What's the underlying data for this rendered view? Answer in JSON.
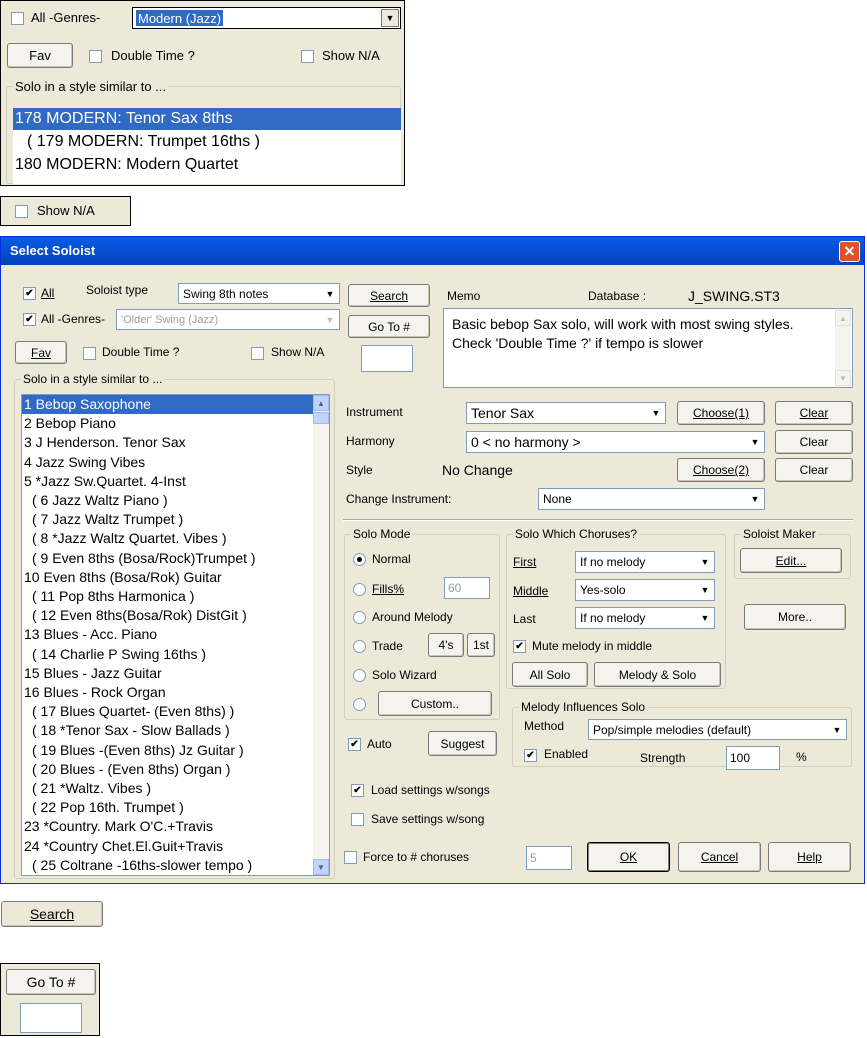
{
  "top_panel": {
    "all_genres": "All -Genres-",
    "genre_value": "Modern (Jazz)",
    "fav": "Fav",
    "double_time": "Double Time ?",
    "show_na": "Show N/A",
    "group_caption": "Solo in a style similar to ...",
    "items": [
      "178 MODERN: Tenor Sax 8ths",
      "( 179 MODERN: Trumpet 16ths )",
      "180 MODERN: Modern Quartet"
    ]
  },
  "show_na_crop": {
    "label": "Show N/A"
  },
  "dialog": {
    "title": "Select Soloist",
    "all": "All",
    "soloist_type_label": "Soloist type",
    "soloist_type_value": "Swing 8th notes",
    "all_genres": "All -Genres-",
    "genre_value": "'Older' Swing (Jazz)",
    "fav": "Fav",
    "double_time": "Double Time ?",
    "show_na": "Show N/A",
    "list_caption": "Solo in a style similar to ...",
    "list_items": [
      "1 Bebop Saxophone",
      "2 Bebop Piano",
      "3 J Henderson. Tenor Sax",
      "4 Jazz Swing Vibes",
      "5 *Jazz Sw.Quartet. 4-Inst",
      "( 6 Jazz Waltz Piano )",
      "( 7 Jazz Waltz Trumpet )",
      "( 8 *Jazz Waltz Quartet. Vibes )",
      "( 9 Even 8ths (Bosa/Rock)Trumpet )",
      "10 Even 8ths (Bosa/Rok) Guitar",
      "( 11 Pop 8ths Harmonica )",
      "( 12 Even 8ths(Bosa/Rok) DistGit )",
      "13 Blues - Acc. Piano",
      "( 14 Charlie P Swing 16ths )",
      "15 Blues - Jazz Guitar",
      "16 Blues - Rock Organ",
      "( 17 Blues Quartet- (Even 8ths) )",
      "( 18 *Tenor Sax - Slow Ballads )",
      "( 19 Blues -(Even 8ths) Jz Guitar )",
      "( 20 Blues - (Even 8ths) Organ )",
      "( 21 *Waltz. Vibes )",
      "( 22  Pop 16th. Trumpet )",
      "23 *Country. Mark O'C.+Travis",
      "24 *Country Chet.El.Guit+Travis",
      "( 25 Coltrane -16ths-slower tempo )"
    ],
    "search": "Search",
    "goto": "Go To #",
    "memo_label": "Memo",
    "database_label": "Database :",
    "database_value": "J_SWING.ST3",
    "memo_text": "Basic bebop Sax solo, will work with most swing styles. Check 'Double Time ?' if tempo is slower",
    "instrument_label": "Instrument",
    "instrument_value": "Tenor Sax",
    "choose1": "Choose(1)",
    "clear": "Clear",
    "harmony_label": "Harmony",
    "harmony_value": "0 < no harmony >",
    "style_label": "Style",
    "style_value": "No Change",
    "choose2": "Choose(2)",
    "change_instrument_label": "Change Instrument:",
    "change_instrument_value": "None",
    "solo_mode": {
      "caption": "Solo Mode",
      "normal": "Normal",
      "fills": "Fills%",
      "fills_value": "60",
      "around_melody": "Around Melody",
      "trade": "Trade",
      "trade_4s": "4's",
      "trade_1st": "1st",
      "solo_wizard": "Solo Wizard",
      "custom": "Custom.."
    },
    "choruses": {
      "caption": "Solo Which Choruses?",
      "first_label": "First",
      "first_value": "If no melody",
      "middle_label": "Middle",
      "middle_value": "Yes-solo",
      "last_label": "Last",
      "last_value": "If no melody",
      "mute": "Mute melody in middle",
      "all_solo": "All Solo",
      "melody_solo": "Melody & Solo"
    },
    "soloist_maker": {
      "caption": "Soloist Maker",
      "edit": "Edit..."
    },
    "more": "More..",
    "auto": "Auto",
    "suggest": "Suggest",
    "influences": {
      "caption": "Melody Influences Solo",
      "method_label": "Method",
      "method_value": "Pop/simple melodies (default)",
      "enabled": "Enabled",
      "strength_label": "Strength",
      "strength_value": "100",
      "percent": "%"
    },
    "load_settings": "Load settings w/songs",
    "save_settings": "Save settings w/song",
    "force": "Force to # choruses",
    "force_value": "5",
    "ok": "OK",
    "cancel": "Cancel",
    "help": "Help"
  },
  "search_crop": {
    "label": "Search"
  },
  "goto_crop": {
    "label": "Go To #"
  }
}
